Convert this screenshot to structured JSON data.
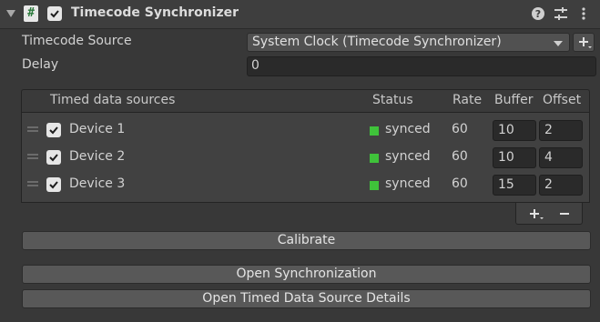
{
  "component": {
    "title": "Timecode Synchronizer",
    "enabled": true,
    "icons": [
      "help-icon",
      "preset-icon",
      "context-menu-icon"
    ]
  },
  "fields": {
    "timecode_source_label": "Timecode Source",
    "timecode_source_value": "System Clock (Timecode Synchronizer)",
    "delay_label": "Delay",
    "delay_value": "0"
  },
  "list": {
    "headers": {
      "name": "Timed data sources",
      "status": "Status",
      "rate": "Rate",
      "buffer": "Buffer",
      "offset": "Offset"
    },
    "rows": [
      {
        "name": "Device 1",
        "enabled": true,
        "status": "synced",
        "rate": "60",
        "buffer": "10",
        "offset": "2"
      },
      {
        "name": "Device 2",
        "enabled": true,
        "status": "synced",
        "rate": "60",
        "buffer": "10",
        "offset": "4"
      },
      {
        "name": "Device 3",
        "enabled": true,
        "status": "synced",
        "rate": "60",
        "buffer": "15",
        "offset": "2"
      }
    ],
    "status_color": "#3fc23a"
  },
  "buttons": {
    "calibrate": "Calibrate",
    "open_sync": "Open Synchronization",
    "open_details": "Open Timed Data Source Details"
  }
}
